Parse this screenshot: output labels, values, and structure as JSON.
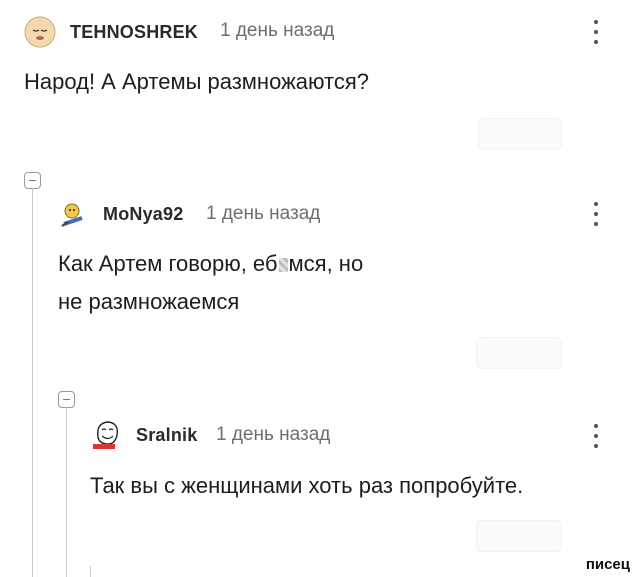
{
  "comments": [
    {
      "username": "TEHNOSHREK",
      "time": "1 день назад",
      "text_lines": [
        "Народ! А Артемы размножаются?"
      ],
      "avatar_icon": "sleeping-face-avatar"
    },
    {
      "username": "MoNya92",
      "time": "1 день назад",
      "text_before_censor": "Как Артем говорю, еб",
      "text_after_censor": "мся, но",
      "text_line2": "не размножаемся",
      "avatar_icon": "cartoon-character-avatar"
    },
    {
      "username": "Sralnik",
      "time": "1 день назад",
      "text_lines": [
        "Так вы с женщинами хоть раз попробуйте."
      ],
      "avatar_icon": "meme-face-avatar"
    }
  ],
  "watermark": "писец",
  "colors": {
    "thread": "#c9c9c9",
    "text": "#1d1d1d",
    "meta": "#6e6e6e"
  }
}
